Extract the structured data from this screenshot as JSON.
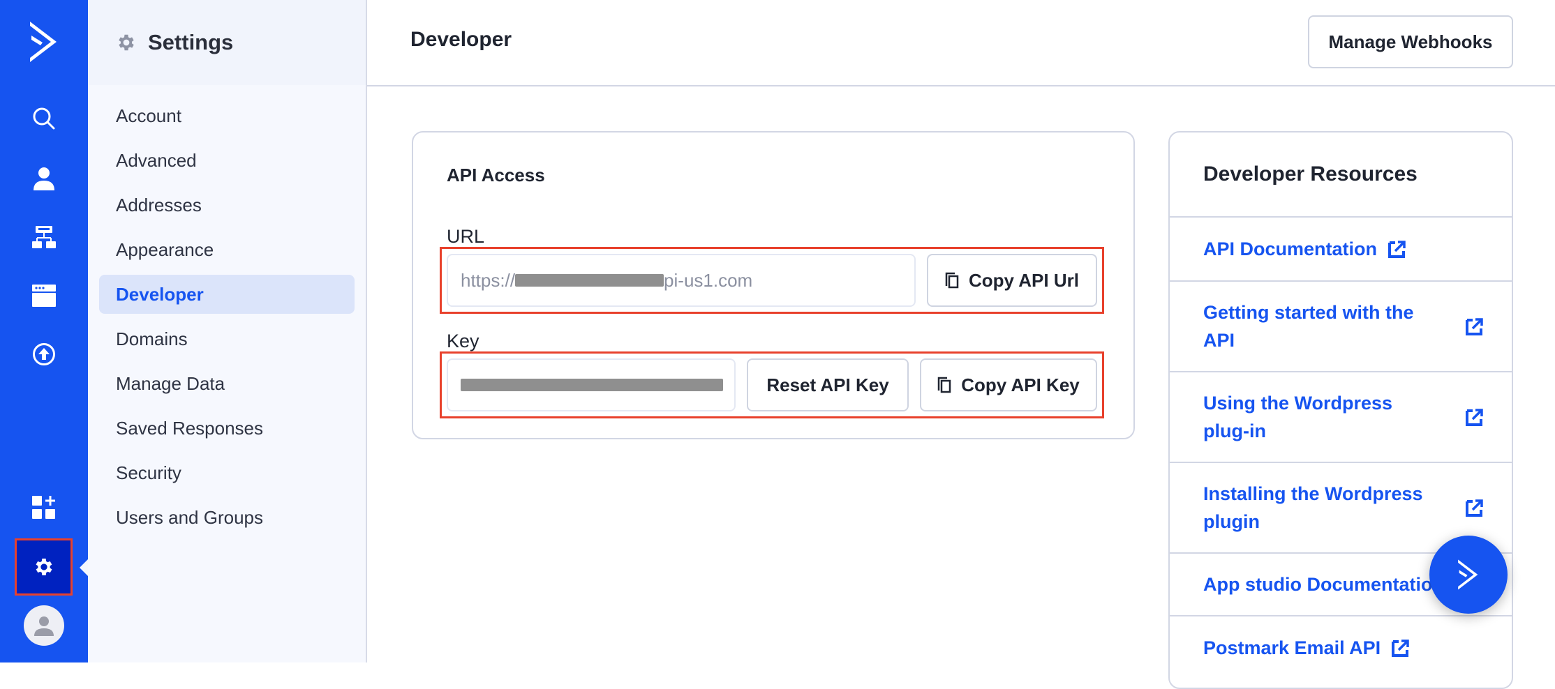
{
  "rail": {
    "items": [
      {
        "name": "logo",
        "icon": "activecampaign-logo-icon"
      },
      {
        "name": "search",
        "icon": "search-icon"
      },
      {
        "name": "contacts",
        "icon": "person-icon"
      },
      {
        "name": "automations",
        "icon": "sitemap-icon"
      },
      {
        "name": "campaigns",
        "icon": "browser-window-icon"
      },
      {
        "name": "upload",
        "icon": "upload-circle-icon"
      },
      {
        "name": "apps",
        "icon": "apps-add-icon"
      },
      {
        "name": "settings",
        "icon": "gear-icon",
        "active": true
      },
      {
        "name": "account",
        "icon": "avatar-icon"
      }
    ]
  },
  "settings": {
    "title": "Settings",
    "items": [
      {
        "label": "Account"
      },
      {
        "label": "Advanced"
      },
      {
        "label": "Addresses"
      },
      {
        "label": "Appearance"
      },
      {
        "label": "Developer",
        "active": true
      },
      {
        "label": "Domains"
      },
      {
        "label": "Manage Data"
      },
      {
        "label": "Saved Responses"
      },
      {
        "label": "Security"
      },
      {
        "label": "Users and Groups"
      }
    ]
  },
  "header": {
    "title": "Developer",
    "manage_webhooks_label": "Manage Webhooks"
  },
  "api_access": {
    "title": "API Access",
    "url_label": "URL",
    "url_prefix": "https://",
    "url_suffix": "pi-us1.com",
    "copy_url_label": "Copy API Url",
    "key_label": "Key",
    "reset_key_label": "Reset API Key",
    "copy_key_label": "Copy API Key"
  },
  "resources": {
    "title": "Developer Resources",
    "links": [
      {
        "label": "API Documentation"
      },
      {
        "label": "Getting started with the API"
      },
      {
        "label": "Using the Wordpress plug-in"
      },
      {
        "label": "Installing the Wordpress plugin"
      },
      {
        "label": "App studio Documentation"
      },
      {
        "label": "Postmark Email API"
      }
    ]
  },
  "colors": {
    "brand": "#1654f0",
    "rail_active": "#0022c0",
    "highlight": "#e8412c",
    "nav_active_bg": "#dbe4fa"
  }
}
